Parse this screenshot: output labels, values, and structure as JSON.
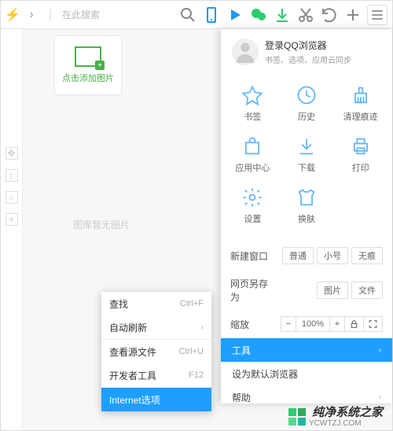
{
  "topbar": {
    "search_placeholder": "在此搜索"
  },
  "sidebar_card": {
    "add_image": "点击添加图片"
  },
  "gallery": {
    "empty": "图库暂无图片"
  },
  "context_menu": {
    "find": {
      "label": "查找",
      "shortcut": "Ctrl+F"
    },
    "auto_refresh": {
      "label": "自动刷新"
    },
    "view_source": {
      "label": "查看源文件",
      "shortcut": "Ctrl+U"
    },
    "dev_tools": {
      "label": "开发者工具",
      "shortcut": "F12"
    },
    "internet_options": {
      "label": "Internet选项"
    }
  },
  "main_menu": {
    "user": {
      "title": "登录QQ浏览器",
      "subtitle": "书签、选项、应用云同步"
    },
    "grid": {
      "bookmarks": "书签",
      "history": "历史",
      "clear": "清理痕迹",
      "app_center": "应用中心",
      "download": "下载",
      "print": "打印",
      "settings": "设置",
      "skin": "换肤"
    },
    "rows": {
      "new_window": "新建窗口",
      "tabs": {
        "normal": "普通",
        "small": "小号",
        "incognito": "无痕"
      },
      "save_as": "网页另存为",
      "save_tabs": {
        "image": "图片",
        "file": "文件"
      },
      "zoom_label": "缩放",
      "zoom_value": "100%"
    },
    "list": {
      "tools": "工具",
      "set_default": "设为默认浏览器",
      "help": "帮助"
    }
  },
  "watermark": {
    "brand": "纯净系统之家",
    "url": "YCWTZJ.COM"
  }
}
